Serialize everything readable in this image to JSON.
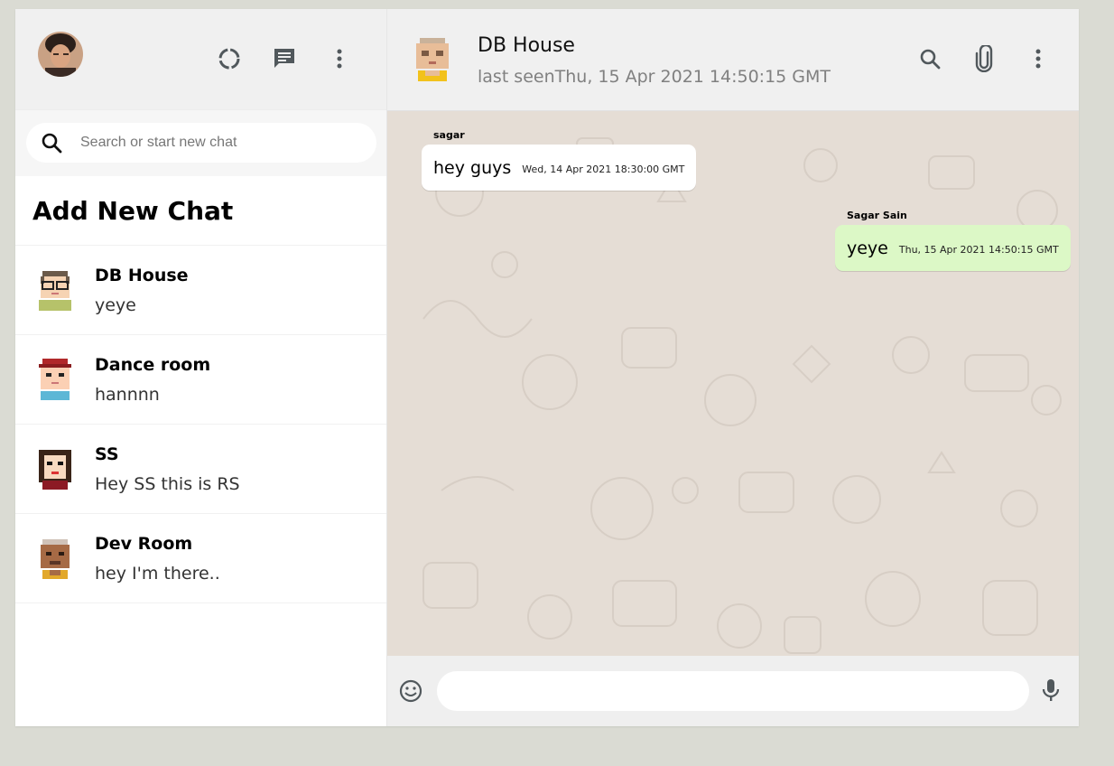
{
  "sidebar": {
    "search": {
      "placeholder": "Search or start new chat"
    },
    "add_new_chat": "Add New Chat",
    "chats": [
      {
        "name": "DB House",
        "last": "yeye",
        "avatar": "pixel-avatar-glasses"
      },
      {
        "name": "Dance room",
        "last": "hannnn",
        "avatar": "pixel-avatar-red-cap"
      },
      {
        "name": "SS",
        "last": "Hey SS this is RS",
        "avatar": "pixel-avatar-long-hair"
      },
      {
        "name": "Dev Room",
        "last": "hey I'm there..",
        "avatar": "pixel-avatar-brown"
      }
    ]
  },
  "chat": {
    "name": "DB House",
    "last_seen": "last seenThu, 15 Apr 2021 14:50:15 GMT",
    "messages": [
      {
        "author": "sagar",
        "text": "hey guys",
        "time": "Wed, 14 Apr 2021 18:30:00 GMT",
        "mine": false
      },
      {
        "author": "Sagar Sain",
        "text": "yeye",
        "time": "Thu, 15 Apr 2021 14:50:15 GMT",
        "mine": true
      }
    ],
    "input": {
      "value": ""
    }
  },
  "colors": {
    "header_bg": "#f0f0f0",
    "chat_bg": "#e5ddd5",
    "sent_bubble": "#dcf8c6",
    "received_bubble": "#ffffff",
    "page_bg": "#dadbd3"
  }
}
